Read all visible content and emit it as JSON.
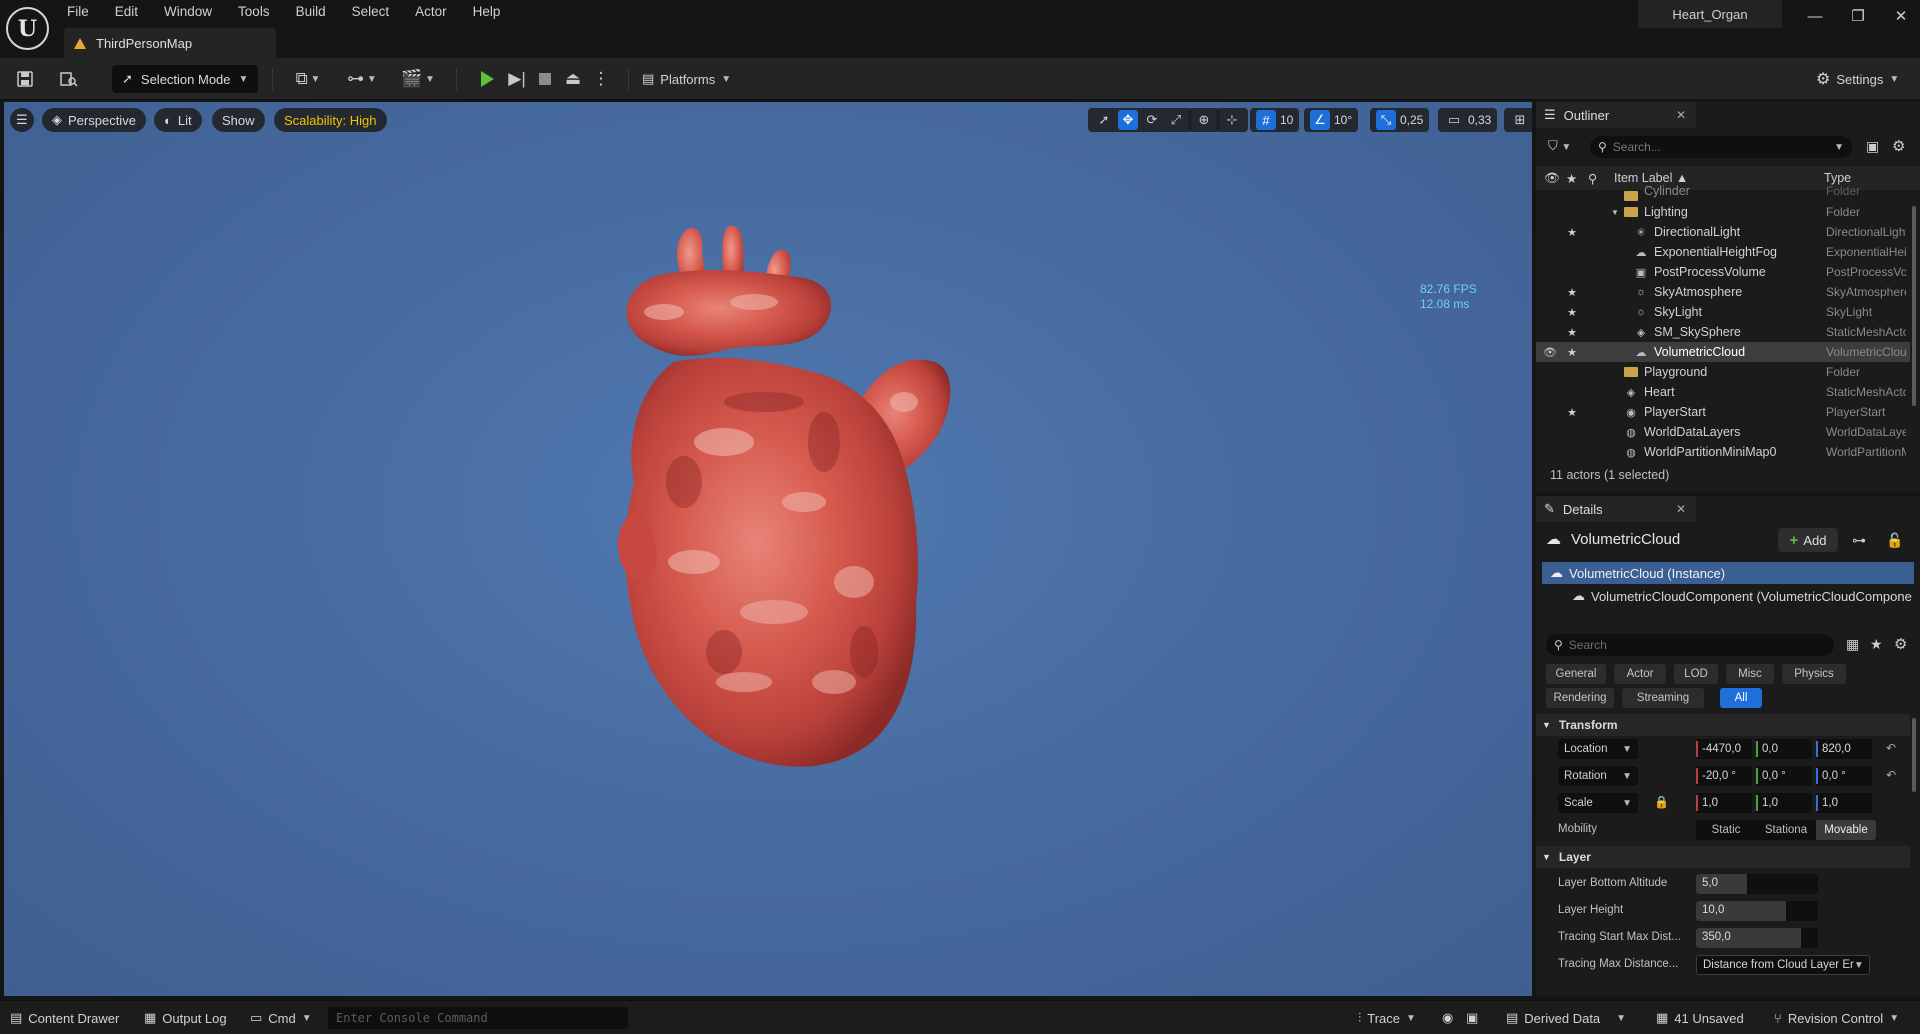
{
  "menu": [
    "File",
    "Edit",
    "Window",
    "Tools",
    "Build",
    "Select",
    "Actor",
    "Help"
  ],
  "document_tab": "ThirdPersonMap",
  "project_name": "Heart_Organ",
  "toolbar": {
    "selection_mode": "Selection Mode",
    "platforms": "Platforms",
    "settings": "Settings"
  },
  "viewport": {
    "perspective": "Perspective",
    "lit": "Lit",
    "show": "Show",
    "scalability": "Scalability: High",
    "grid_snap": "10",
    "rotation_snap": "10°",
    "scale_snap": "0,25",
    "camera_speed": "0,33",
    "fps": "82.76 FPS",
    "frame_ms": "12.08 ms"
  },
  "outliner": {
    "tab": "Outliner",
    "search_placeholder": "Search...",
    "col_label": "Item Label ▲",
    "col_type": "Type",
    "rows": [
      {
        "name": "Cylinder",
        "type": "Folder",
        "indent": 1,
        "star": false,
        "icon": "folder"
      },
      {
        "name": "Lighting",
        "type": "Folder",
        "indent": 1,
        "star": false,
        "icon": "folder"
      },
      {
        "name": "DirectionalLight",
        "type": "DirectionalLight",
        "indent": 2,
        "star": true,
        "icon": "sun"
      },
      {
        "name": "ExponentialHeightFog",
        "type": "ExponentialHeightFog",
        "indent": 2,
        "star": false,
        "icon": "fog"
      },
      {
        "name": "PostProcessVolume",
        "type": "PostProcessVolume",
        "indent": 2,
        "star": false,
        "icon": "box"
      },
      {
        "name": "SkyAtmosphere",
        "type": "SkyAtmosphere",
        "indent": 2,
        "star": true,
        "icon": "sky"
      },
      {
        "name": "SkyLight",
        "type": "SkyLight",
        "indent": 2,
        "star": true,
        "icon": "skylight"
      },
      {
        "name": "SM_SkySphere",
        "type": "StaticMeshActor",
        "indent": 2,
        "star": true,
        "icon": "mesh"
      },
      {
        "name": "VolumetricCloud",
        "type": "VolumetricCloud",
        "indent": 2,
        "star": true,
        "icon": "cloud",
        "selected": true
      },
      {
        "name": "Playground",
        "type": "Folder",
        "indent": 1,
        "star": false,
        "icon": "folder"
      },
      {
        "name": "Heart",
        "type": "StaticMeshActor",
        "indent": 1,
        "star": false,
        "icon": "mesh"
      },
      {
        "name": "PlayerStart",
        "type": "PlayerStart",
        "indent": 1,
        "star": true,
        "icon": "player"
      },
      {
        "name": "WorldDataLayers",
        "type": "WorldDataLayers",
        "indent": 1,
        "star": false,
        "icon": "globe"
      },
      {
        "name": "WorldPartitionMiniMap0",
        "type": "WorldPartitionMiniMap",
        "indent": 1,
        "star": false,
        "icon": "globe"
      }
    ],
    "footer": "11 actors (1 selected)"
  },
  "details": {
    "tab": "Details",
    "actor": "VolumetricCloud",
    "add": "Add",
    "instance": "VolumetricCloud (Instance)",
    "component": "VolumetricCloudComponent (VolumetricCloudCompone",
    "search_placeholder": "Search",
    "categories": [
      "General",
      "Actor",
      "LOD",
      "Misc",
      "Physics",
      "Rendering",
      "Streaming",
      "All"
    ],
    "transform_section": "Transform",
    "location_label": "Location",
    "location": [
      "-4470,0",
      "0,0",
      "820,0"
    ],
    "rotation_label": "Rotation",
    "rotation": [
      "-20,0 °",
      "0,0 °",
      "0,0 °"
    ],
    "scale_label": "Scale",
    "scale": [
      "1,0",
      "1,0",
      "1,0"
    ],
    "mobility_label": "Mobility",
    "mobility": [
      "Static",
      "Stationa",
      "Movable"
    ],
    "layer_section": "Layer",
    "layer_bottom_label": "Layer Bottom Altitude",
    "layer_bottom": "5,0",
    "layer_bottom_level": 0.42,
    "layer_height_label": "Layer Height",
    "layer_height": "10,0",
    "layer_height_level": 0.74,
    "tracing_start_label": "Tracing Start Max Dist...",
    "tracing_start": "350,0",
    "tracing_start_level": 0.86,
    "tracing_max_label": "Tracing Max Distance...",
    "tracing_max": "Distance from Cloud Layer Er"
  },
  "statusbar": {
    "content_drawer": "Content Drawer",
    "output_log": "Output Log",
    "cmd": "Cmd",
    "console_placeholder": "Enter Console Command",
    "trace": "Trace",
    "derived_data": "Derived Data",
    "unsaved": "41 Unsaved",
    "revision_control": "Revision Control"
  },
  "colors": {
    "accent": "#1e6fd9",
    "play": "#5fbf3a",
    "scalability": "#f0c400",
    "fps": "#6fd0f0",
    "selection_row": "#3a5f93"
  }
}
